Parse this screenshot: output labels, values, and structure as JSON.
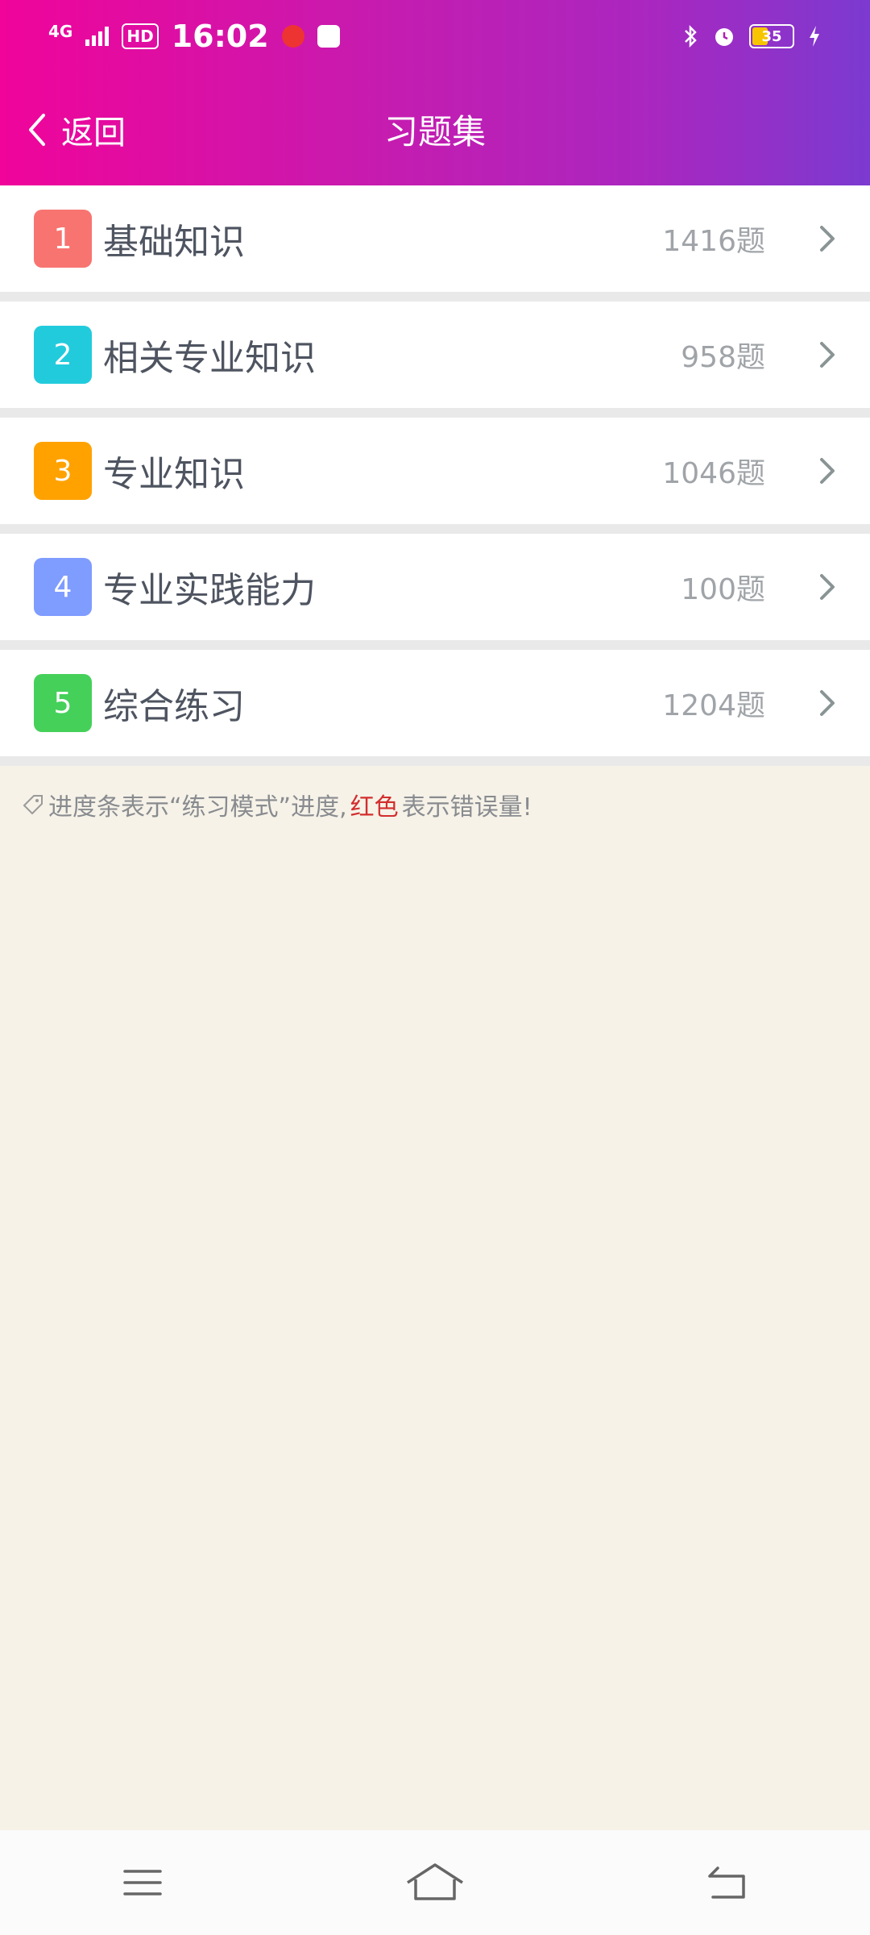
{
  "status": {
    "network": "4G",
    "hd": "HD",
    "time": "16:02",
    "battery": "35"
  },
  "nav": {
    "back_label": "返回",
    "title": "习题集"
  },
  "items": [
    {
      "index": "1",
      "label": "基础知识",
      "count": "1416题",
      "color": "#f87470"
    },
    {
      "index": "2",
      "label": "相关专业知识",
      "count": "958题",
      "color": "#22cbdc"
    },
    {
      "index": "3",
      "label": "专业知识",
      "count": "1046题",
      "color": "#ffa200"
    },
    {
      "index": "4",
      "label": "专业实践能力",
      "count": "100题",
      "color": "#7f9cff"
    },
    {
      "index": "5",
      "label": "综合练习",
      "count": "1204题",
      "color": "#45d05a"
    }
  ],
  "hint": {
    "prefix": "进度条表示“练习模式”进度,",
    "red": "红色",
    "suffix": "表示错误量!"
  },
  "icons": {
    "back": "chevron-left-icon",
    "row_arrow": "chevron-right-icon",
    "hint": "tag-icon",
    "menu": "menu-icon",
    "home": "home-icon",
    "return": "return-icon"
  }
}
